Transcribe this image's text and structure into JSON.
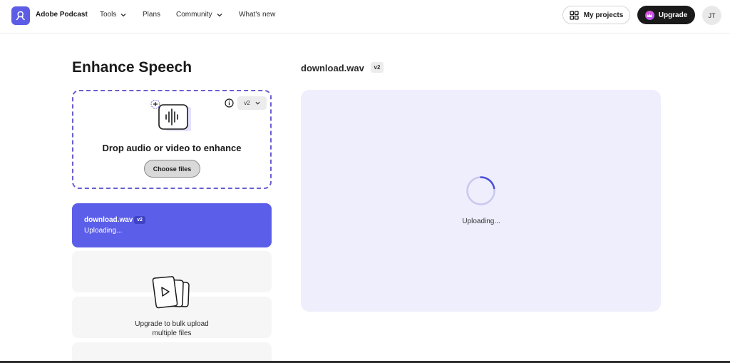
{
  "header": {
    "brand": "Adobe Podcast",
    "nav": [
      {
        "label": "Tools"
      },
      {
        "label": "Plans"
      },
      {
        "label": "Community"
      },
      {
        "label": "What's new"
      }
    ],
    "my_projects_label": "My projects",
    "upgrade_label": "Upgrade",
    "avatar_initials": "JT"
  },
  "page": {
    "title": "Enhance Speech"
  },
  "dropzone": {
    "version": "v2",
    "prompt": "Drop audio or video to enhance",
    "choose_label": "Choose files"
  },
  "file_card": {
    "name": "download.wav",
    "badge": "v2",
    "status": "Uploading..."
  },
  "bulk": {
    "line1": "Upgrade to bulk upload",
    "line2": "multiple files"
  },
  "preview": {
    "file_name": "download.wav",
    "badge": "v2",
    "status": "Uploading..."
  },
  "colors": {
    "accent": "#5b5ee8",
    "dashed_border": "#6a5fd0",
    "preview_bg": "#eeeefd"
  }
}
